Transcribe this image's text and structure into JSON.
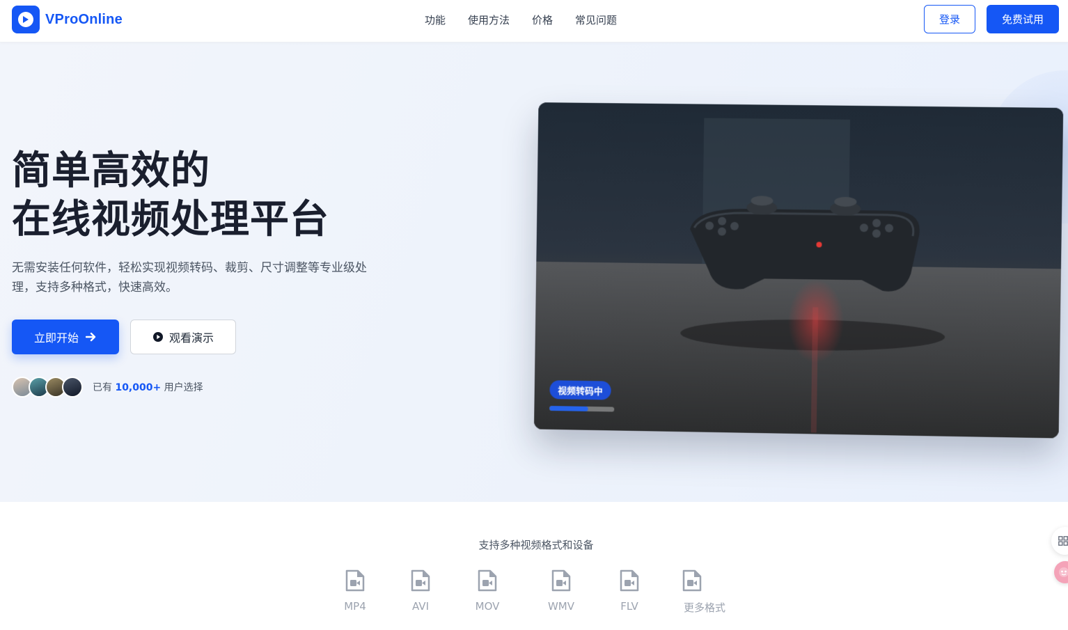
{
  "app": {
    "brand": "VProOnline"
  },
  "nav": {
    "items": [
      "功能",
      "使用方法",
      "价格",
      "常见问题"
    ]
  },
  "header": {
    "login_label": "登录",
    "trial_label": "免费试用"
  },
  "hero": {
    "title_line1": "简单高效的",
    "title_line2": "在线视频处理平台",
    "subtitle": "无需安装任何软件，轻松实现视频转码、裁剪、尺寸调整等专业级处理，支持多种格式，快速高效。",
    "start_label": "立即开始",
    "demo_label": "观看演示",
    "users_prefix": "已有",
    "users_count": "10,000+",
    "users_suffix": "用户选择"
  },
  "video_card": {
    "status_badge": "视频转码中",
    "progress": 0.6
  },
  "formats": {
    "title": "支持多种视频格式和设备",
    "items": [
      "MP4",
      "AVI",
      "MOV",
      "WMV",
      "FLV",
      "更多格式"
    ]
  },
  "colors": {
    "accent": "#1557f5",
    "text_dark": "#1a1f2e",
    "muted": "#9ca3af"
  }
}
